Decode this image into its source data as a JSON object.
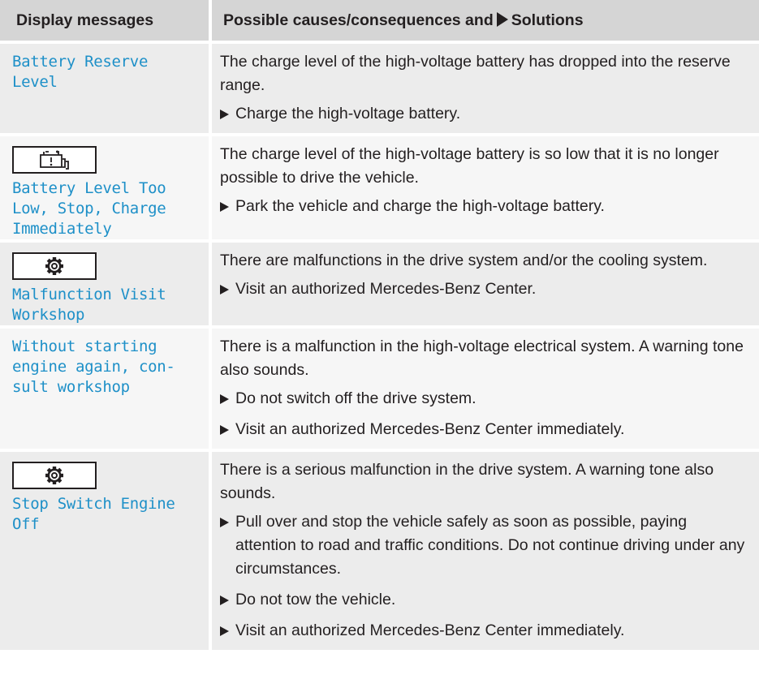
{
  "header": {
    "col1": "Display messages",
    "col2_prefix": "Possible causes/consequences and",
    "col2_suffix": "Solutions"
  },
  "rows": [
    {
      "message": "Battery Reserve\nLevel",
      "icon": "",
      "cause": "The charge level of the high-voltage battery has dropped into the reserve range.",
      "steps": [
        "Charge the high-voltage battery."
      ]
    },
    {
      "message": "Battery Level Too\nLow, Stop, Charge\nImmediately",
      "icon": "battery-warning-icon",
      "cause": "The charge level of the high-voltage battery is so low that it is no longer possible to drive the vehicle.",
      "steps": [
        "Park the vehicle and charge the high-voltage battery."
      ]
    },
    {
      "message": "Malfunction Visit\nWorkshop",
      "icon": "gear-icon",
      "cause": "There are malfunctions in the drive system and/or the cooling system.",
      "steps": [
        "Visit an authorized Mercedes-Benz Center."
      ]
    },
    {
      "message": "Without starting\nengine again, con-\nsult workshop",
      "icon": "",
      "cause": "There is a malfunction in the high-voltage electrical system. A warning tone also sounds.",
      "steps": [
        "Do not switch off the drive system.",
        "Visit an authorized Mercedes-Benz Center immediately."
      ]
    },
    {
      "message": "Stop Switch Engine\nOff",
      "icon": "gear-icon",
      "cause": "There is a serious malfunction in the drive system. A warning tone also sounds.",
      "steps": [
        "Pull over and stop the vehicle safely as soon as possible, paying attention to road and traffic conditions. Do not continue driving under any circumstances.",
        "Do not tow the vehicle.",
        "Visit an authorized Mercedes-Benz Center immediately."
      ]
    }
  ]
}
